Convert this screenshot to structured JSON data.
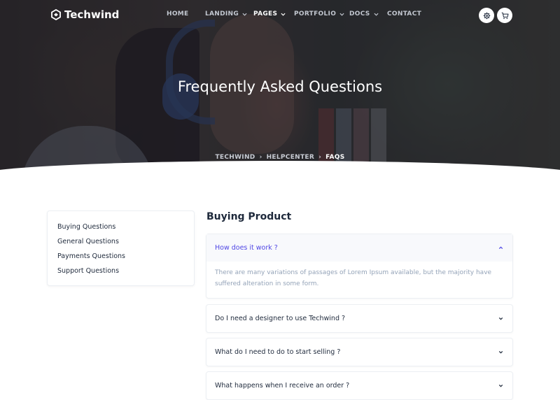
{
  "brand": {
    "name": "Techwind"
  },
  "nav": {
    "items": [
      {
        "label": "HOME",
        "dropdown": false,
        "active": false
      },
      {
        "label": "LANDING",
        "dropdown": true,
        "active": false
      },
      {
        "label": "PAGES",
        "dropdown": true,
        "active": true
      },
      {
        "label": "PORTFOLIO",
        "dropdown": true,
        "active": false
      },
      {
        "label": "DOCS",
        "dropdown": true,
        "active": false
      },
      {
        "label": "CONTACT",
        "dropdown": false,
        "active": false
      }
    ],
    "buttons": [
      "settings-icon",
      "cart-icon"
    ]
  },
  "hero": {
    "title": "Frequently Asked Questions",
    "breadcrumb": [
      "TECHWIND",
      "HELPCENTER",
      "FAQS"
    ]
  },
  "sidebar": {
    "links": [
      "Buying Questions",
      "General Questions",
      "Payments Questions",
      "Support Questions"
    ]
  },
  "main": {
    "section_title": "Buying Product",
    "faqs": [
      {
        "question": "How does it work ?",
        "open": true,
        "answer": "There are many variations of passages of Lorem Ipsum available, but the majority have suffered alteration in some form."
      },
      {
        "question": "Do I need a designer to use Techwind ?",
        "open": false
      },
      {
        "question": "What do I need to do to start selling ?",
        "open": false
      },
      {
        "question": "What happens when I receive an order ?",
        "open": false
      }
    ]
  },
  "colors": {
    "accent": "#4f46e5",
    "text": "#1e293b",
    "muted": "#94a3b8",
    "border": "#eceff3"
  }
}
